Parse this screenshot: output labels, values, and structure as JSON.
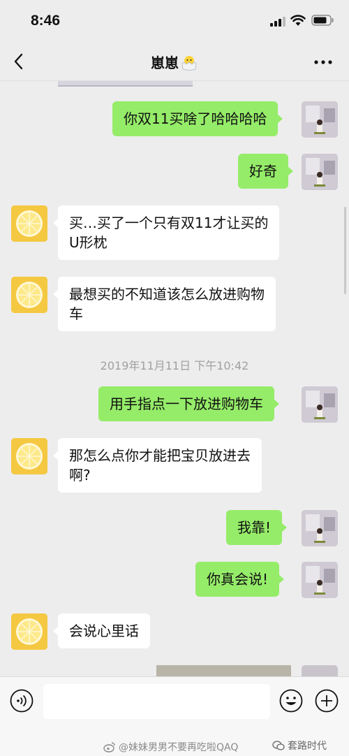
{
  "status_bar": {
    "time": "8:46"
  },
  "nav": {
    "title": "崽崽"
  },
  "timestamp": "2019年11月11日 下午10:42",
  "messages": [
    {
      "side": "right",
      "text": "你双11买啥了哈哈哈哈"
    },
    {
      "side": "right",
      "text": "好奇"
    },
    {
      "side": "left",
      "text": "买…买了一个只有双11才让买的\nU形枕"
    },
    {
      "side": "left",
      "text": "最想买的不知道该怎么放进购物\n车"
    },
    {
      "side": "right",
      "text": "用手指点一下放进购物车"
    },
    {
      "side": "left",
      "text": "那怎么点你才能把宝贝放进去\n啊?"
    },
    {
      "side": "right",
      "text": "我靠!"
    },
    {
      "side": "right",
      "text": "你真会说!"
    },
    {
      "side": "left",
      "text": "会说心里话"
    }
  ],
  "watermark": {
    "text": "@妹妹男男不要再吃啦QAQ",
    "logo": "套路时代"
  },
  "colors": {
    "background": "#ededed",
    "bubble_sent": "#95ec69",
    "bubble_received": "#ffffff",
    "avatar_lemon": "#f5c842"
  }
}
